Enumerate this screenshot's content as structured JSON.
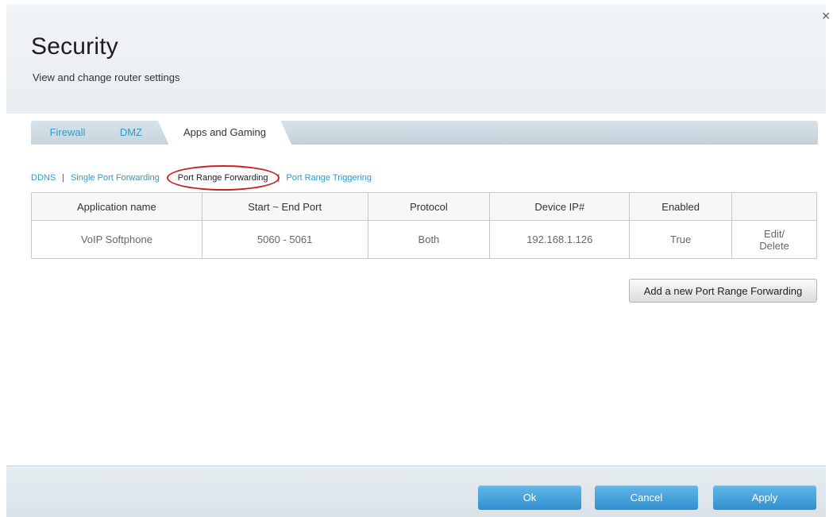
{
  "header": {
    "title": "Security",
    "subtitle": "View and change router settings",
    "close_icon": "close-icon"
  },
  "tabs": [
    {
      "label": "Firewall",
      "active": false
    },
    {
      "label": "DMZ",
      "active": false
    },
    {
      "label": "Apps and Gaming",
      "active": true
    }
  ],
  "subnav": {
    "items": [
      "DDNS",
      "Single Port Forwarding",
      "Port Range Forwarding",
      "Port Range Triggering"
    ],
    "current": "Port Range Forwarding",
    "separator": "|"
  },
  "table": {
    "columns": [
      "Application name",
      "Start ~ End Port",
      "Protocol",
      "Device IP#",
      "Enabled",
      ""
    ],
    "rows": [
      {
        "application_name": "VoIP Softphone",
        "ports": "5060 - 5061",
        "protocol": "Both",
        "device_ip": "192.168.1.126",
        "enabled": "True",
        "edit_label": "Edit/",
        "delete_label": "Delete"
      }
    ]
  },
  "add_button_label": "Add a new Port Range Forwarding",
  "footer": {
    "ok_label": "Ok",
    "cancel_label": "Cancel",
    "apply_label": "Apply"
  },
  "colors": {
    "link": "#2e9bc6",
    "primary_button": "#3c9bd6",
    "highlight_circle": "#cc1f1f"
  }
}
